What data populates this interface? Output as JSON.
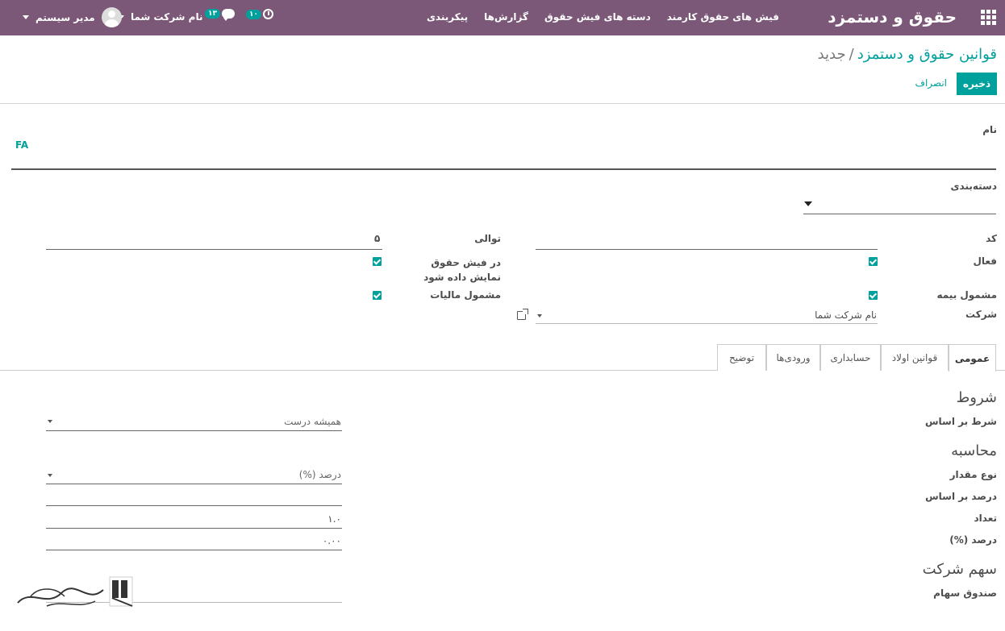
{
  "navbar": {
    "brand": "حقوق و دستمزد",
    "menu": [
      "فیش های حقوق کارمند",
      "دسته های فیش حقوق",
      "گزارش‌ها",
      "پیکربندی"
    ],
    "user_name": "مدیر سیستم",
    "company": "نام شرکت شما",
    "messages_count": "۱۳",
    "activities_count": "۱۰"
  },
  "breadcrumb": {
    "parent": "قوانین حقوق و دستمزد",
    "separator": "/",
    "current": "جدید"
  },
  "buttons": {
    "save": "ذخیره",
    "discard": "انصراف"
  },
  "form": {
    "name_label": "نام",
    "lang_button": "FA",
    "category_label": "دسته‌بندی",
    "code_label": "کد",
    "sequence_label": "توالی",
    "sequence_value": "۵",
    "active_label": "فعال",
    "show_in_payslip_label": "در فیش حقوق نمایش داده شود",
    "insurance_label": "مشمول بیمه",
    "tax_label": "مشمول مالیات",
    "company_label": "شرکت",
    "company_value": "نام شرکت شما"
  },
  "tabs": [
    "عمومی",
    "قوانین اولاد",
    "حسابداری",
    "ورودی‌ها",
    "توضیح"
  ],
  "general": {
    "conditions_title": "شروط",
    "condition_based_label": "شرط بر اساس",
    "condition_based_value": "همیشه درست",
    "computation_title": "محاسبه",
    "amount_type_label": "نوع مقدار",
    "amount_type_value": "درصد (%)",
    "percentage_based_label": "درصد بر اساس",
    "quantity_label": "تعداد",
    "quantity_value": "۱.۰",
    "percentage_label": "درصد (%)",
    "percentage_value": "۰.۰۰",
    "company_share_title": "سهم شرکت",
    "equity_fund_label": "صندوق سهام"
  },
  "colors": {
    "navbar": "#7c5878",
    "accent": "#00a09d"
  }
}
